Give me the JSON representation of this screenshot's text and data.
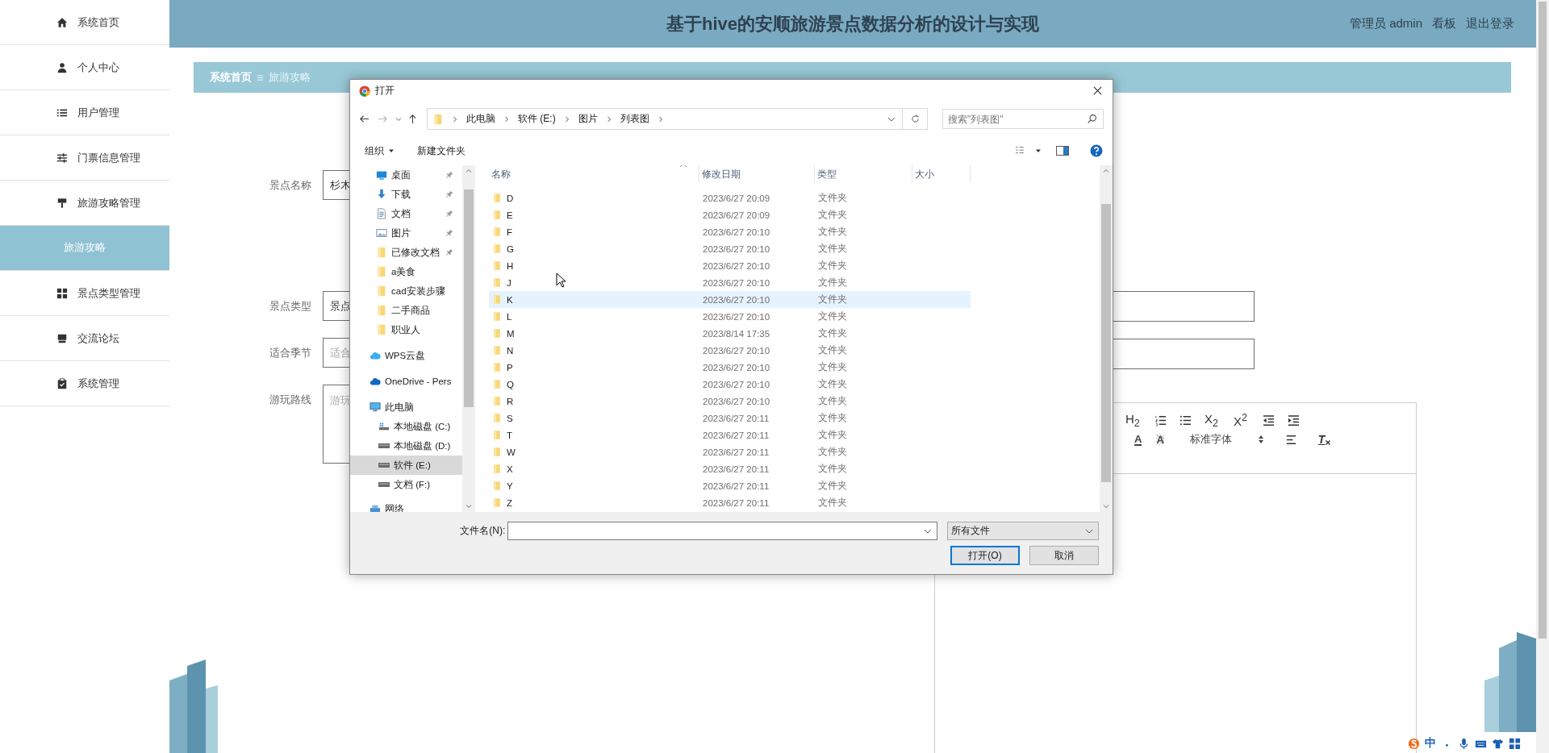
{
  "sidebar": {
    "items": [
      {
        "label": "系统首页",
        "kind": "menu",
        "selected": false
      },
      {
        "label": "个人中心",
        "kind": "menu",
        "selected": false
      },
      {
        "label": "用户管理",
        "kind": "menu",
        "selected": false
      },
      {
        "label": "门票信息管理",
        "kind": "menu",
        "selected": false
      },
      {
        "label": "旅游攻略管理",
        "kind": "menu",
        "selected": false
      },
      {
        "label": "旅游攻略",
        "kind": "submenu",
        "selected": true
      },
      {
        "label": "景点类型管理",
        "kind": "menu",
        "selected": false
      },
      {
        "label": "交流论坛",
        "kind": "menu",
        "selected": false
      },
      {
        "label": "系统管理",
        "kind": "menu",
        "selected": false
      }
    ]
  },
  "header": {
    "title": "基于hive的安顺旅游景点数据分析的设计与实现",
    "user": "管理员 admin",
    "links": [
      "看板",
      "退出登录"
    ]
  },
  "breadcrumb": [
    "系统首页",
    "旅游攻略"
  ],
  "form": {
    "fields": [
      {
        "label": "景点名称",
        "kind": "input",
        "value": "杉木"
      },
      {
        "label": "景点类型",
        "kind": "input",
        "value": "景点"
      },
      {
        "label": "适合季节",
        "kind": "input",
        "placeholder": "适合"
      },
      {
        "label": "游玩路线",
        "kind": "textarea",
        "placeholder": "游玩"
      }
    ],
    "editor": {
      "row_1": [
        {
          "kind": "text",
          "label": "H$_{2}$"
        },
        {
          "kind": "ordered-list"
        },
        {
          "kind": "bullet-list"
        },
        {
          "kind": "text",
          "label": "X$_{2}$"
        },
        {
          "kind": "text",
          "label": "X$^{2}$"
        },
        {
          "kind": "outdent"
        },
        {
          "kind": "indent"
        }
      ],
      "row_2": [
        {
          "kind": "font-color",
          "label": "A"
        },
        {
          "kind": "background-color",
          "label": "A"
        },
        {
          "kind": "select",
          "label": "标准字体"
        },
        {
          "kind": "align"
        },
        {
          "kind": "clear-format",
          "label": "T"
        }
      ]
    }
  },
  "dialog": {
    "title": "打开",
    "path": [
      "此电脑",
      "软件 (E:)",
      "图片",
      "列表图"
    ],
    "search_placeholder": "搜索\"列表图\"",
    "commands": [
      "组织",
      "新建文件夹"
    ],
    "quick": [
      {
        "label": "桌面",
        "kind": "desktop",
        "pinned": true,
        "selected": false
      },
      {
        "label": "下载",
        "kind": "download",
        "pinned": true,
        "selected": false
      },
      {
        "label": "文档",
        "kind": "documents",
        "pinned": true,
        "selected": false
      },
      {
        "label": "图片",
        "kind": "pictures",
        "pinned": true,
        "selected": false
      },
      {
        "label": "已修改文档",
        "kind": "folder",
        "pinned": true,
        "selected": false
      },
      {
        "label": "a美食",
        "kind": "folder",
        "pinned": false,
        "selected": false
      },
      {
        "label": "cad安装步骤",
        "kind": "folder",
        "pinned": false,
        "selected": false
      },
      {
        "label": "二手商品",
        "kind": "folder",
        "pinned": false,
        "selected": false
      },
      {
        "label": "职业人",
        "kind": "folder",
        "pinned": false,
        "selected": false
      }
    ],
    "places": [
      {
        "label": "WPS云盘",
        "kind": "cloud-light",
        "selected": false
      },
      {
        "label": "OneDrive - Pers",
        "kind": "cloud",
        "selected": false
      },
      {
        "label": "此电脑",
        "kind": "computer",
        "selected": false,
        "children": [
          {
            "label": "本地磁盘 (C:)",
            "kind": "system-drive",
            "selected": false
          },
          {
            "label": "本地磁盘 (D:)",
            "kind": "drive",
            "selected": false
          },
          {
            "label": "软件 (E:)",
            "kind": "drive",
            "selected": true
          },
          {
            "label": "文档 (F:)",
            "kind": "drive",
            "selected": false
          }
        ]
      },
      {
        "label": "网络",
        "kind": "network",
        "selected": false
      }
    ],
    "columns": [
      "名称",
      "修改日期",
      "类型",
      "大小"
    ],
    "files": [
      {
        "name": "D",
        "modified": "2023/6/27 20:09",
        "type": "文件夹",
        "selected": false
      },
      {
        "name": "E",
        "modified": "2023/6/27 20:09",
        "type": "文件夹",
        "selected": false
      },
      {
        "name": "F",
        "modified": "2023/6/27 20:10",
        "type": "文件夹",
        "selected": false
      },
      {
        "name": "G",
        "modified": "2023/6/27 20:10",
        "type": "文件夹",
        "selected": false
      },
      {
        "name": "H",
        "modified": "2023/6/27 20:10",
        "type": "文件夹",
        "selected": false
      },
      {
        "name": "J",
        "modified": "2023/6/27 20:10",
        "type": "文件夹",
        "selected": false
      },
      {
        "name": "K",
        "modified": "2023/6/27 20:10",
        "type": "文件夹",
        "selected": true
      },
      {
        "name": "L",
        "modified": "2023/6/27 20:10",
        "type": "文件夹",
        "selected": false
      },
      {
        "name": "M",
        "modified": "2023/8/14 17:35",
        "type": "文件夹",
        "selected": false
      },
      {
        "name": "N",
        "modified": "2023/6/27 20:10",
        "type": "文件夹",
        "selected": false
      },
      {
        "name": "P",
        "modified": "2023/6/27 20:10",
        "type": "文件夹",
        "selected": false
      },
      {
        "name": "Q",
        "modified": "2023/6/27 20:10",
        "type": "文件夹",
        "selected": false
      },
      {
        "name": "R",
        "modified": "2023/6/27 20:10",
        "type": "文件夹",
        "selected": false
      },
      {
        "name": "S",
        "modified": "2023/6/27 20:11",
        "type": "文件夹",
        "selected": false
      },
      {
        "name": "T",
        "modified": "2023/6/27 20:11",
        "type": "文件夹",
        "selected": false
      },
      {
        "name": "W",
        "modified": "2023/6/27 20:11",
        "type": "文件夹",
        "selected": false
      },
      {
        "name": "X",
        "modified": "2023/6/27 20:11",
        "type": "文件夹",
        "selected": false
      },
      {
        "name": "Y",
        "modified": "2023/6/27 20:11",
        "type": "文件夹",
        "selected": false
      },
      {
        "name": "Z",
        "modified": "2023/6/27 20:11",
        "type": "文件夹",
        "selected": false
      }
    ],
    "filename_label": "文件名(N):",
    "filter": "所有文件",
    "buttons": [
      {
        "label": "打开(O)",
        "default": true
      },
      {
        "label": "取消",
        "default": false
      }
    ]
  },
  "ime": {
    "mode": "中"
  }
}
